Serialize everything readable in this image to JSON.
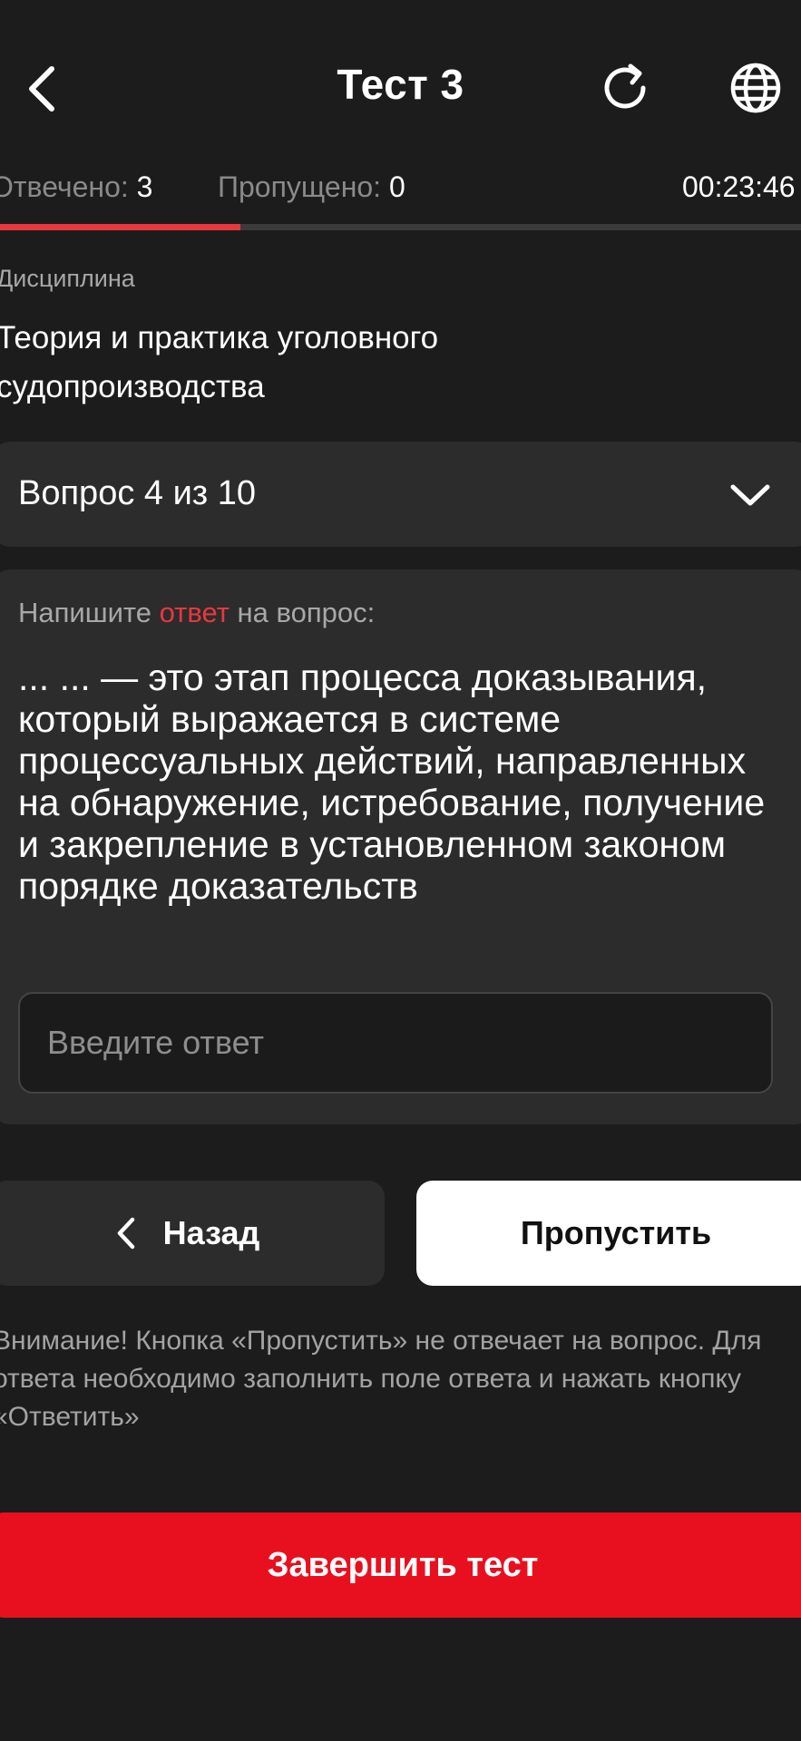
{
  "header": {
    "title": "Тест 3",
    "back_icon": "chevron-left-icon",
    "refresh_icon": "refresh-icon",
    "language_icon": "globe-icon"
  },
  "stats": {
    "answered_label": "Отвечено:",
    "answered_value": "3",
    "skipped_label": "Пропущено:",
    "skipped_value": "0",
    "timer": "00:23:46"
  },
  "progress": {
    "percent": 30
  },
  "discipline": {
    "label": "Дисциплина",
    "name": "Теория и практика уголовного судопроизводства"
  },
  "question_selector": {
    "label": "Вопрос 4 из 10",
    "icon": "chevron-down-icon"
  },
  "question": {
    "prompt_before": "Напишите ",
    "prompt_accent": "ответ",
    "prompt_after": " на вопрос:",
    "text": "... ... — это этап процесса доказывания, который выражается в системе процессуальных действий, направленных на обнаружение, истребование, получение и закрепление в установленном законом порядке доказательств",
    "input_value": "",
    "input_placeholder": "Введите ответ"
  },
  "actions": {
    "back_label": "Назад",
    "skip_label": "Пропустить",
    "warning": "Внимание! Кнопка «Пропустить» не отвечает на вопрос. Для ответа необходимо заполнить поле ответа и нажать кнопку «Ответить»",
    "finish_label": "Завершить тест"
  },
  "colors": {
    "background": "#1c1c1c",
    "card": "#2c2c2c",
    "accent": "#e8373f",
    "finish_button": "#e8101f"
  }
}
